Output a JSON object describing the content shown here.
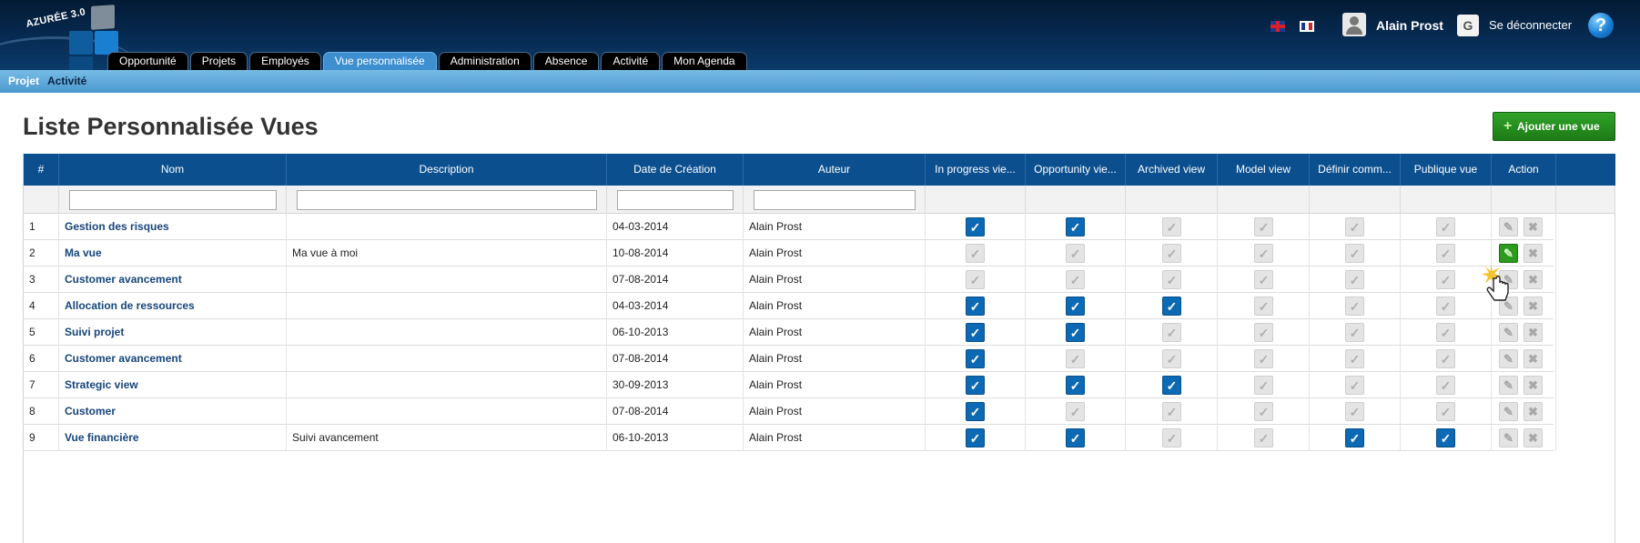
{
  "app": {
    "logo_text": "AZURÉE 3.0"
  },
  "nav": {
    "tabs": [
      {
        "label": "Opportunité",
        "active": false
      },
      {
        "label": "Projets",
        "active": false
      },
      {
        "label": "Employés",
        "active": false
      },
      {
        "label": "Vue personnalisée",
        "active": true
      },
      {
        "label": "Administration",
        "active": false
      },
      {
        "label": "Absence",
        "active": false
      },
      {
        "label": "Activité",
        "active": false
      },
      {
        "label": "Mon Agenda",
        "active": false
      }
    ]
  },
  "header": {
    "user_name": "Alain Prost",
    "logout_label": "Se déconnecter",
    "flags": [
      "uk-flag-icon",
      "fr-flag-icon"
    ],
    "help_icon": "?"
  },
  "subnav": {
    "projet": "Projet",
    "activite": "Activité"
  },
  "page": {
    "title": "Liste Personnalisée Vues",
    "add_button_label": "Ajouter une vue"
  },
  "table": {
    "columns": [
      "#",
      "Nom",
      "Description",
      "Date de Création",
      "Auteur",
      "In progress vie...",
      "Opportunity vie...",
      "Archived view",
      "Model view",
      "Définir comm...",
      "Publique vue",
      "Action"
    ],
    "rows": [
      {
        "num": "1",
        "name": "Gestion des risques",
        "description": "",
        "date": "04-03-2014",
        "author": "Alain Prost",
        "flags": [
          true,
          true,
          false,
          false,
          false,
          false
        ]
      },
      {
        "num": "2",
        "name": "Ma vue",
        "description": "Ma vue à moi",
        "date": "10-08-2014",
        "author": "Alain Prost",
        "flags": [
          false,
          false,
          false,
          false,
          false,
          false
        ]
      },
      {
        "num": "3",
        "name": "Customer avancement",
        "description": "",
        "date": "07-08-2014",
        "author": "Alain Prost",
        "flags": [
          false,
          false,
          false,
          false,
          false,
          false
        ]
      },
      {
        "num": "4",
        "name": "Allocation de ressources",
        "description": "",
        "date": "04-03-2014",
        "author": "Alain Prost",
        "flags": [
          true,
          true,
          true,
          false,
          false,
          false
        ]
      },
      {
        "num": "5",
        "name": "Suivi projet",
        "description": "",
        "date": "06-10-2013",
        "author": "Alain Prost",
        "flags": [
          true,
          true,
          false,
          false,
          false,
          false
        ]
      },
      {
        "num": "6",
        "name": "Customer avancement",
        "description": "",
        "date": "07-08-2014",
        "author": "Alain Prost",
        "flags": [
          true,
          false,
          false,
          false,
          false,
          false
        ]
      },
      {
        "num": "7",
        "name": "Strategic view",
        "description": "",
        "date": "30-09-2013",
        "author": "Alain Prost",
        "flags": [
          true,
          true,
          true,
          false,
          false,
          false
        ]
      },
      {
        "num": "8",
        "name": "Customer",
        "description": "",
        "date": "07-08-2014",
        "author": "Alain Prost",
        "flags": [
          true,
          false,
          false,
          false,
          false,
          false
        ]
      },
      {
        "num": "9",
        "name": "Vue financière",
        "description": "Suivi avancement",
        "date": "06-10-2013",
        "author": "Alain Prost",
        "flags": [
          true,
          true,
          false,
          false,
          true,
          true
        ]
      }
    ],
    "highlighted_edit_row": 2
  },
  "colors": {
    "header_bg": "#06284d",
    "table_header": "#0b4f8f",
    "checkbox_on": "#0c69b3",
    "add_button": "#2fa228"
  }
}
